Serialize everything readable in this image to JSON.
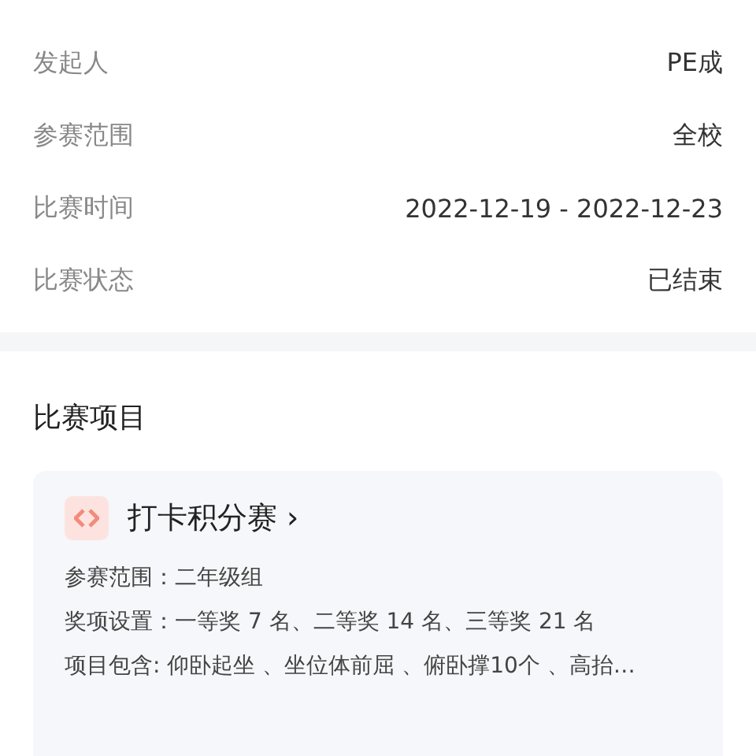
{
  "details": [
    {
      "label": "发起人",
      "value": "PE成"
    },
    {
      "label": "参赛范围",
      "value": "全校"
    },
    {
      "label": "比赛时间",
      "value": "2022-12-19 - 2022-12-23"
    },
    {
      "label": "比赛状态",
      "value": "已结束"
    }
  ],
  "section": {
    "title": "比赛项目"
  },
  "project": {
    "name": "打卡积分赛",
    "chevron": "›",
    "lines": [
      "参赛范围：二年级组",
      "奖项设置：一等奖 7 名、二等奖 14 名、三等奖 21 名",
      "项目包含: 仰卧起坐 、坐位体前屈 、俯卧撑10个 、高抬…"
    ]
  }
}
